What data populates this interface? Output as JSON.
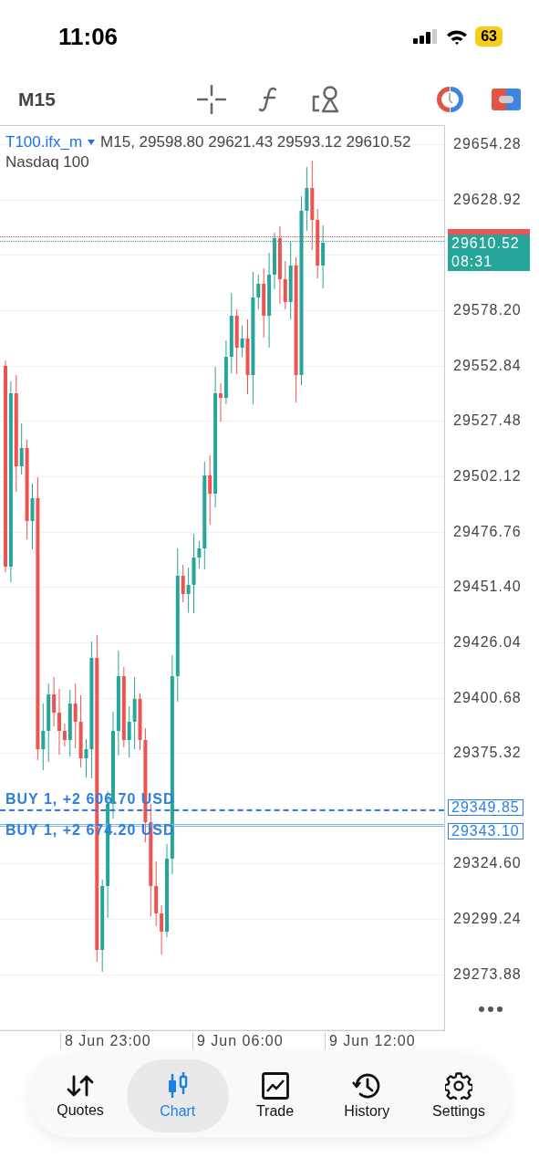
{
  "status_bar": {
    "time": "11:06",
    "battery": "63"
  },
  "toolbar": {
    "timeframe": "M15"
  },
  "chart": {
    "symbol": "T100.ifx_m",
    "info": "M15, 29598.80 29621.43 29593.12 29610.52",
    "description": "Nasdaq 100",
    "y_axis_labels": [
      "29654.28",
      "29628.92",
      "29578.20",
      "29552.84",
      "29527.48",
      "29502.12",
      "29476.76",
      "29451.40",
      "29426.04",
      "29400.68",
      "29375.32",
      "29324.60",
      "29299.24",
      "29273.88"
    ],
    "x_axis_labels": [
      "8 Jun 23:00",
      "9 Jun 06:00",
      "9 Jun 12:00"
    ],
    "bid_label": {
      "price": "29610.52",
      "countdown": "08:31"
    },
    "orders": [
      {
        "label": "BUY 1, +2 606.70 USD",
        "price": "29349.85"
      },
      {
        "label": "BUY 1, +2 674.20 USD",
        "price": "29343.10"
      }
    ]
  },
  "tabs": [
    {
      "label": "Quotes",
      "selected": false
    },
    {
      "label": "Chart",
      "selected": true
    },
    {
      "label": "Trade",
      "selected": false
    },
    {
      "label": "History",
      "selected": false
    },
    {
      "label": "Settings",
      "selected": false
    }
  ]
}
